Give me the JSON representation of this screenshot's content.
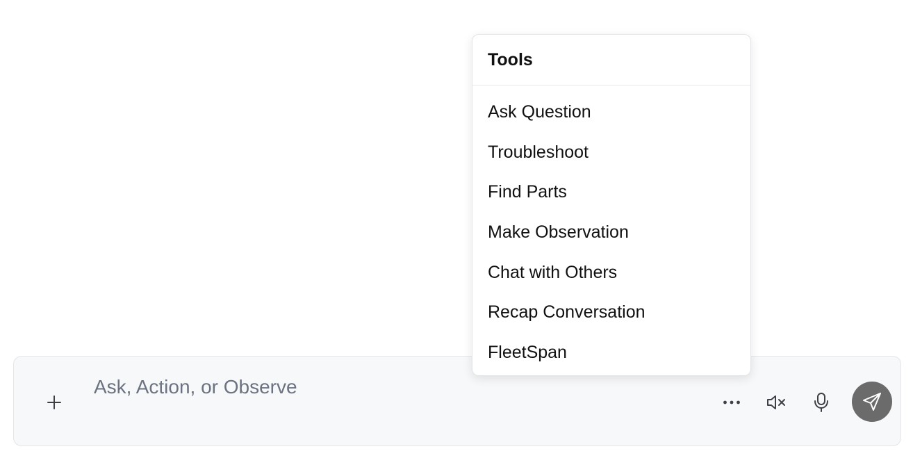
{
  "tools_menu": {
    "title": "Tools",
    "items": [
      {
        "label": "Ask Question"
      },
      {
        "label": "Troubleshoot"
      },
      {
        "label": "Find Parts"
      },
      {
        "label": "Make Observation"
      },
      {
        "label": "Chat with Others"
      },
      {
        "label": "Recap Conversation"
      },
      {
        "label": "FleetSpan"
      }
    ]
  },
  "composer": {
    "placeholder": "Ask, Action, or Observe",
    "value": "",
    "icons": {
      "add": "plus-icon",
      "more": "more-horizontal-icon",
      "mute": "volume-muted-icon",
      "mic": "microphone-icon",
      "send": "send-icon"
    }
  },
  "colors": {
    "composer_background": "#f7f8fa",
    "placeholder_text": "#6b7280",
    "icon": "#3f3f46",
    "send_button": "#6b6b6b",
    "send_icon": "#ffffff"
  }
}
